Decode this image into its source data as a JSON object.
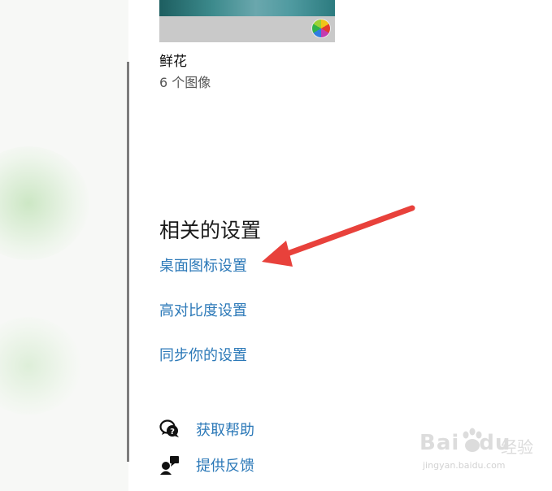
{
  "theme": {
    "name": "鲜花",
    "count": "6 个图像"
  },
  "related": {
    "title": "相关的设置",
    "links": [
      {
        "label": "桌面图标设置"
      },
      {
        "label": "高对比度设置"
      },
      {
        "label": "同步你的设置"
      }
    ]
  },
  "help": {
    "items": [
      {
        "label": "获取帮助",
        "icon": "chat-help-icon"
      },
      {
        "label": "提供反馈",
        "icon": "feedback-icon"
      }
    ]
  },
  "watermark": {
    "logo": "Bai",
    "logo_suffix": "du",
    "cn": "经验",
    "url": "jingyan.baidu.com"
  },
  "colors": {
    "link": "#2c79b8",
    "arrow": "#e8413b",
    "divider": "#7d7d7d"
  }
}
